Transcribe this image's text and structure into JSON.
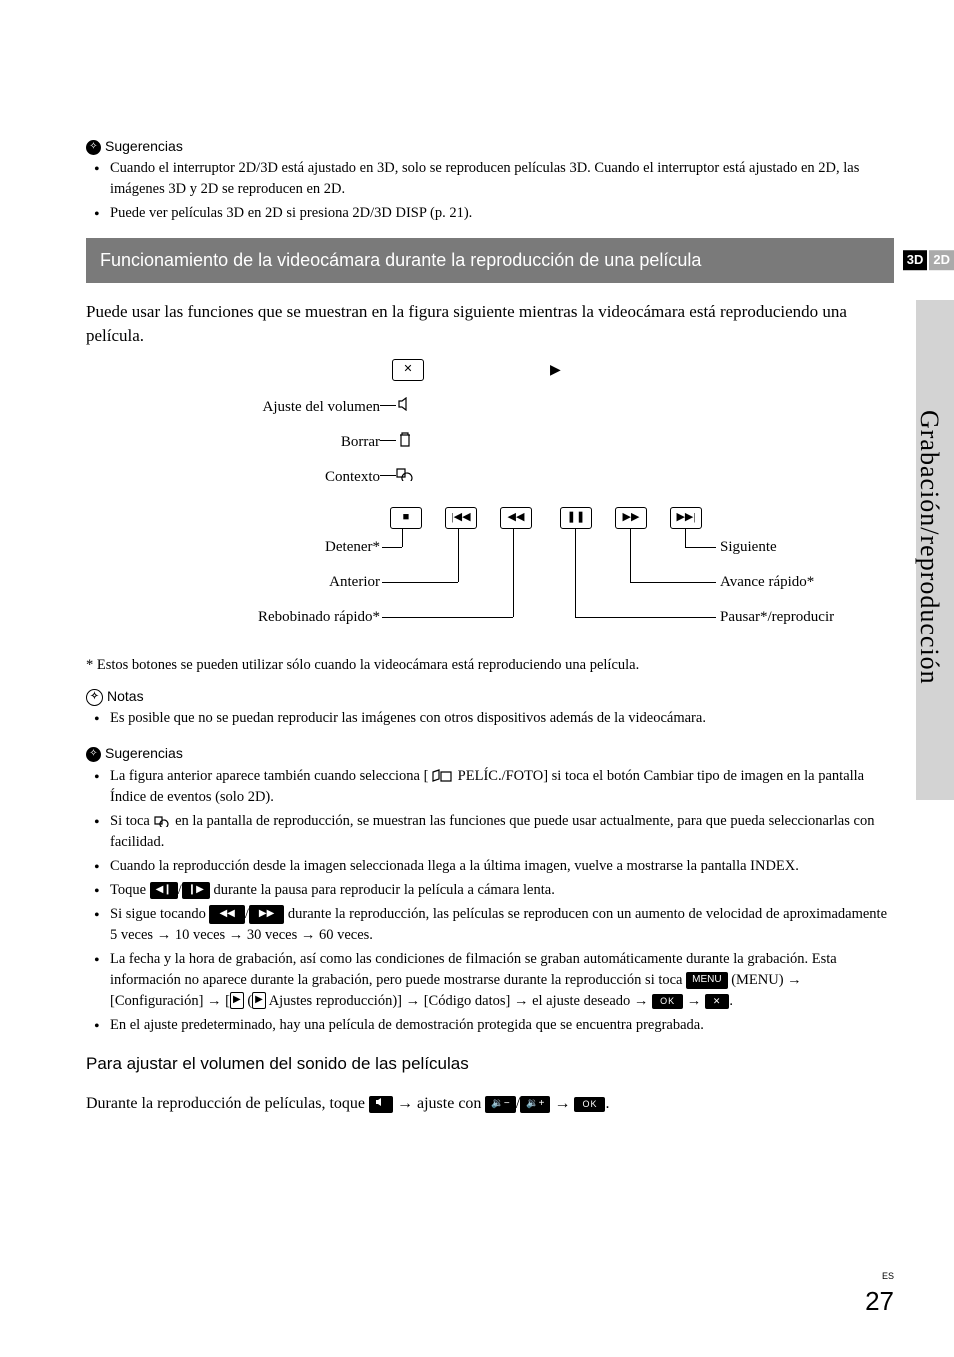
{
  "sideTab": "Grabación/reproducción",
  "sugerencias_label": "Sugerencias",
  "top_tips": [
    "Cuando el interruptor 2D/3D está ajustado en 3D, solo se reproducen películas 3D. Cuando el interruptor está ajustado en 2D, las imágenes 3D y 2D se reproducen en 2D.",
    "Puede ver películas 3D en 2D si presiona 2D/3D DISP (p. 21)."
  ],
  "section_title": "Funcionamiento de la videocámara durante la reproducción de una película",
  "badge3d": "3D",
  "badge2d": "2D",
  "intro": "Puede usar las funciones que se muestran en la figura siguiente mientras la videocámara está reproduciendo una película.",
  "labels": {
    "volumen": "Ajuste del volumen",
    "borrar": "Borrar",
    "contexto": "Contexto",
    "detener": "Detener*",
    "anterior": "Anterior",
    "rew": "Rebobinado rápido*",
    "siguiente": "Siguiente",
    "ff": "Avance rápido*",
    "pausar": "Pausar*/reproducir"
  },
  "footnote": "* Estos botones se pueden utilizar sólo cuando la videocámara está reproduciendo una película.",
  "notas_label": "Notas",
  "notas": [
    "Es posible que no se puedan reproducir las imágenes con otros dispositivos además de la videocámara."
  ],
  "tips2": {
    "t1a": "La figura anterior aparece también cuando selecciona [",
    "t1b": "PELÍC./FOTO] si toca el botón Cambiar tipo de imagen en la pantalla Índice de eventos (solo 2D).",
    "t2": "Si toca ",
    "t2b": " en la pantalla de reproducción, se muestran las funciones que puede usar actualmente, para que pueda seleccionarlas con facilidad.",
    "t3": "Cuando la reproducción desde la imagen seleccionada llega a la última imagen, vuelve a mostrarse la pantalla INDEX.",
    "t4a": "Toque ",
    "t4b": " durante la pausa para reproducir la película a cámara lenta.",
    "t5a": "Si sigue tocando ",
    "t5b": " durante la reproducción, las películas se reproducen con un aumento de velocidad de aproximadamente 5 veces → 10 veces → 30 veces → 60 veces.",
    "t6a": "La fecha y la hora de grabación, así como las condiciones de filmación se graban automáticamente durante la grabación. Esta información no aparece durante la grabación, pero puede mostrarse durante la reproducción si toca ",
    "t6b": " (MENU) → [Configuración] → [",
    "t6c": "Ajustes reproducción)] → [Código datos] → el ajuste deseado → ",
    "t7": "En el ajuste predeterminado, hay una película de demostración protegida que se encuentra pregrabada."
  },
  "subhead": "Para ajustar el volumen del sonido de las películas",
  "vol_line_a": "Durante la reproducción de películas, toque ",
  "vol_line_b": " → ajuste con ",
  "arrow": " → ",
  "menu_label": "MENU",
  "ok_label": "OK",
  "x_label": "✕",
  "page_es": "ES",
  "page_num": "27"
}
